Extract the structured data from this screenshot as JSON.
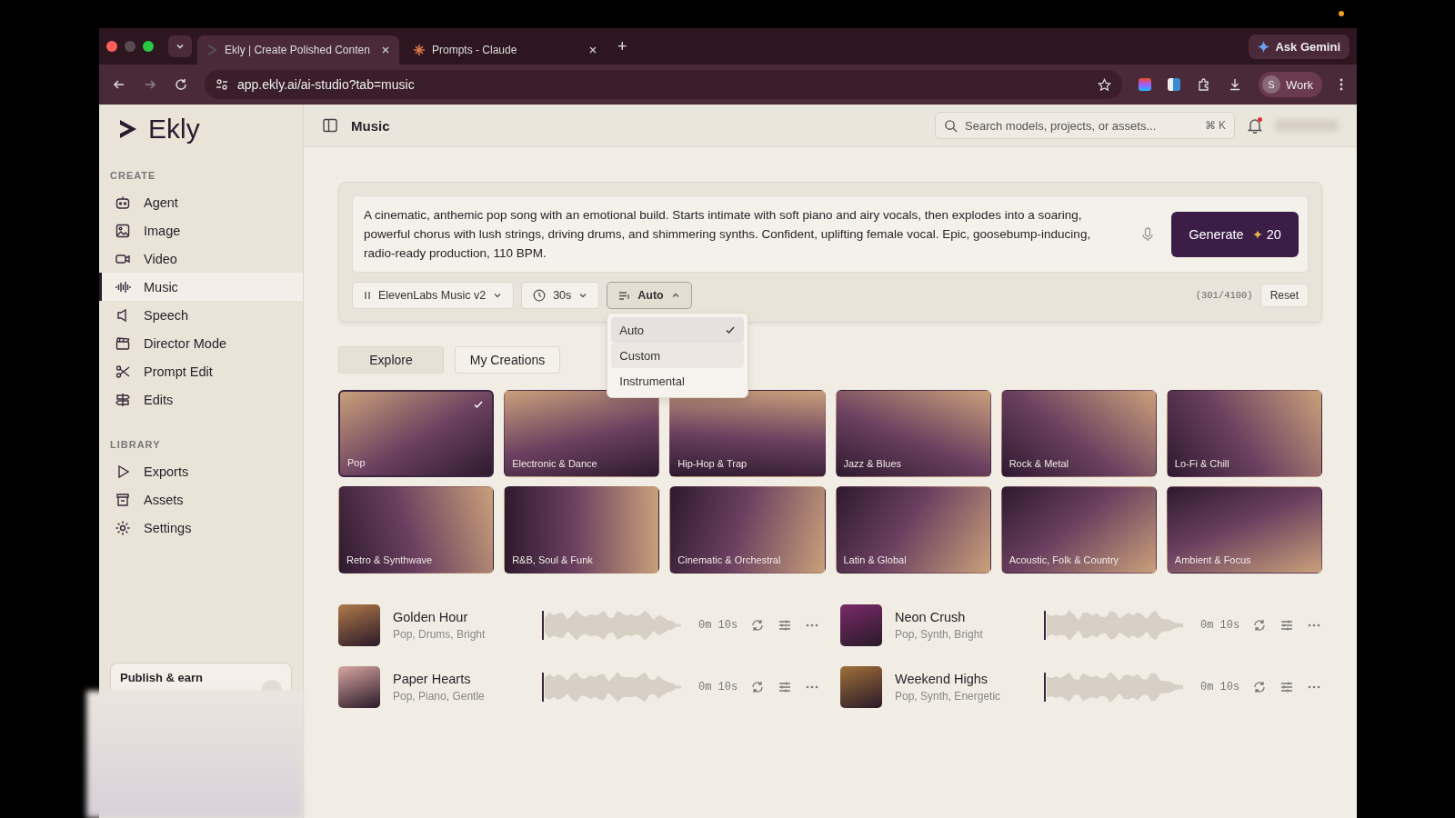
{
  "browser": {
    "tabs": [
      {
        "title": "Ekly | Create Polished Conten",
        "selected": true
      },
      {
        "title": "Prompts - Claude",
        "selected": false
      }
    ],
    "new_tab": "+",
    "assistant": "Ask Gemini",
    "url": "app.ekly.ai/ai-studio?tab=music",
    "profile": {
      "initial": "S",
      "name": "Work"
    }
  },
  "sidebar": {
    "logo": "Ekly",
    "sections": [
      {
        "heading": "CREATE",
        "items": [
          {
            "label": "Agent",
            "selected": false
          },
          {
            "label": "Image",
            "selected": false
          },
          {
            "label": "Video",
            "selected": false
          },
          {
            "label": "Music",
            "selected": true
          },
          {
            "label": "Speech",
            "selected": false
          },
          {
            "label": "Director Mode",
            "selected": false
          },
          {
            "label": "Prompt Edit",
            "selected": false
          },
          {
            "label": "Edits",
            "selected": false
          }
        ]
      },
      {
        "heading": "LIBRARY",
        "items": [
          {
            "label": "Exports",
            "selected": false
          },
          {
            "label": "Assets",
            "selected": false
          },
          {
            "label": "Settings",
            "selected": false
          }
        ]
      }
    ],
    "publish_card": {
      "title": "Publish & earn"
    }
  },
  "header": {
    "title": "Music",
    "search_placeholder": "Search models, projects, or assets...",
    "shortcut": "⌘ K",
    "unread_notifications": true
  },
  "prompt": {
    "text": "A cinematic, anthemic pop song with an emotional build. Starts intimate with soft piano and airy vocals, then explodes into a soaring, powerful chorus with lush strings, driving drums, and shimmering synths. Confident, uplifting female vocal. Epic, goosebump-inducing, radio-ready production, 110 BPM.",
    "generate_label": "Generate",
    "cost": "20",
    "model": "ElevenLabs Music v2",
    "duration": "30s",
    "mode": {
      "label": "Auto",
      "expanded": true,
      "options": [
        {
          "label": "Auto",
          "selected": true,
          "hovered": false
        },
        {
          "label": "Custom",
          "selected": false,
          "hovered": true
        },
        {
          "label": "Instrumental",
          "selected": false,
          "hovered": false
        }
      ]
    },
    "counter": "(301/4100)",
    "reset": "Reset"
  },
  "view_tabs": [
    {
      "label": "Explore",
      "selected": true
    },
    {
      "label": "My Creations",
      "selected": false
    }
  ],
  "genres": [
    {
      "label": "Pop",
      "selected": true
    },
    {
      "label": "Electronic & Dance",
      "selected": false
    },
    {
      "label": "Hip-Hop & Trap",
      "selected": false
    },
    {
      "label": "Jazz & Blues",
      "selected": false
    },
    {
      "label": "Rock & Metal",
      "selected": false
    },
    {
      "label": "Lo-Fi & Chill",
      "selected": false
    },
    {
      "label": "Retro & Synthwave",
      "selected": false
    },
    {
      "label": "R&B, Soul & Funk",
      "selected": false
    },
    {
      "label": "Cinematic & Orchestral",
      "selected": false
    },
    {
      "label": "Latin & Global",
      "selected": false
    },
    {
      "label": "Acoustic, Folk & Country",
      "selected": false
    },
    {
      "label": "Ambient & Focus",
      "selected": false
    }
  ],
  "tracks": [
    {
      "title": "Golden Hour",
      "tags": "Pop, Drums, Bright",
      "duration": "0m 10s"
    },
    {
      "title": "Neon Crush",
      "tags": "Pop, Synth, Bright",
      "duration": "0m 10s"
    },
    {
      "title": "Paper Hearts",
      "tags": "Pop, Piano, Gentle",
      "duration": "0m 10s"
    },
    {
      "title": "Weekend Highs",
      "tags": "Pop, Synth, Energetic",
      "duration": "0m 10s"
    }
  ]
}
